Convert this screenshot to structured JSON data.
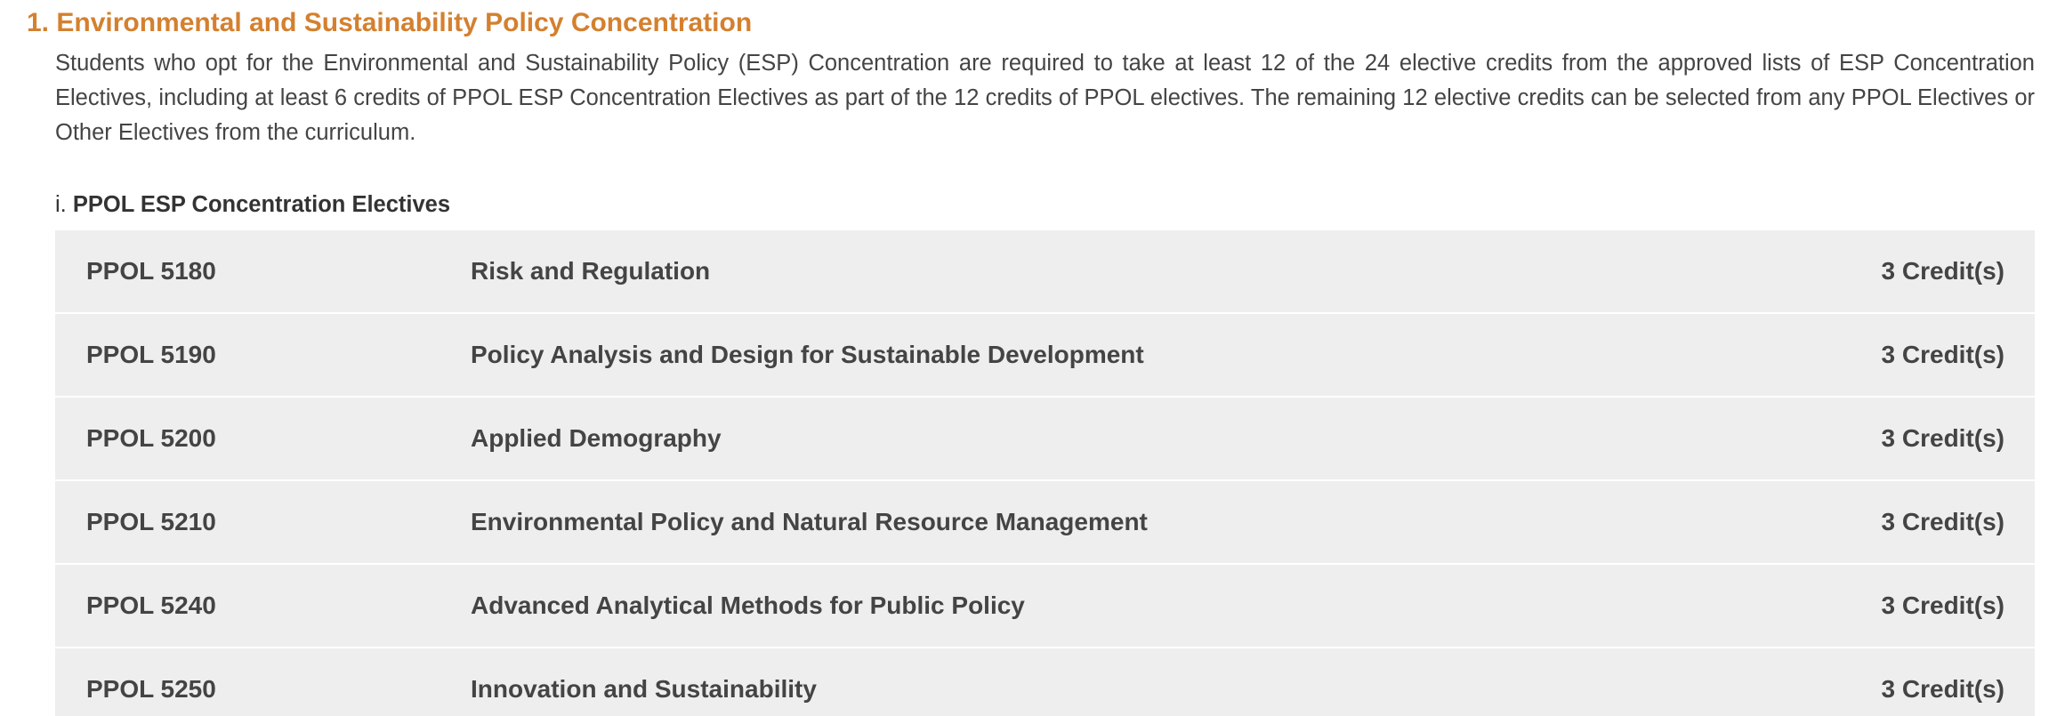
{
  "section": {
    "heading": "1. Environmental and Sustainability Policy Concentration",
    "intro": "Students who opt for the Environmental and Sustainability Policy (ESP) Concentration are required to take at least 12 of the 24 elective credits from the approved lists of ESP Concentration Electives, including at least 6 credits of PPOL ESP Concentration Electives as part of the 12 credits of PPOL electives. The remaining 12 elective credits can be selected from any PPOL Electives or Other Electives from the curriculum."
  },
  "subsection": {
    "numeral": "i.",
    "title": "PPOL ESP Concentration Electives"
  },
  "courses": [
    {
      "code": "PPOL 5180",
      "title": "Risk and Regulation",
      "credits": "3 Credit(s)"
    },
    {
      "code": "PPOL 5190",
      "title": "Policy Analysis and Design for Sustainable Development",
      "credits": "3 Credit(s)"
    },
    {
      "code": "PPOL 5200",
      "title": "Applied Demography",
      "credits": "3 Credit(s)"
    },
    {
      "code": "PPOL 5210",
      "title": "Environmental Policy and Natural Resource Management",
      "credits": "3 Credit(s)"
    },
    {
      "code": "PPOL 5240",
      "title": "Advanced Analytical Methods for Public Policy",
      "credits": "3 Credit(s)"
    },
    {
      "code": "PPOL 5250",
      "title": "Innovation and Sustainability",
      "credits": "3 Credit(s)"
    }
  ],
  "colors": {
    "heading": "#d4802f",
    "text": "#444444",
    "row_background": "#eeeeee"
  }
}
